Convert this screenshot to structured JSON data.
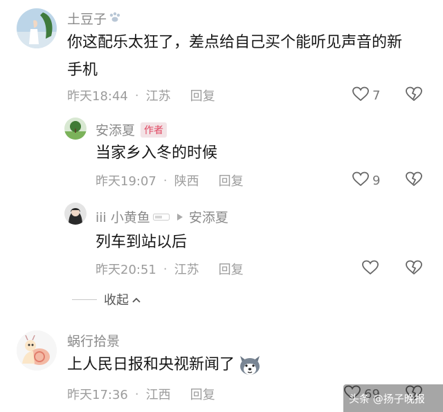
{
  "comments": [
    {
      "user": "土豆子",
      "text_line1": "你这配乐太狂了，差点给自己买个能听见声音的新",
      "text_line2": "手机",
      "time": "昨天18:44",
      "location": "江苏",
      "reply_label": "回复",
      "likes": "7"
    },
    {
      "user": "安添夏",
      "badge": "作者",
      "text": "当家乡入冬的时候",
      "time": "昨天19:07",
      "location": "陕西",
      "reply_label": "回复",
      "likes": "9"
    },
    {
      "user": "iii 小黄鱼",
      "reply_to": "安添夏",
      "text": "列车到站以后",
      "time": "昨天20:51",
      "location": "江苏",
      "reply_label": "回复",
      "likes": ""
    },
    {
      "user": "蜗行拾景",
      "text": "上人民日报和央视新闻了",
      "time": "昨天17:36",
      "location": "江西",
      "reply_label": "回复",
      "likes": "69"
    }
  ],
  "collapse_label": "收起",
  "watermark": "头条 @扬子晚报",
  "colors": {
    "author_badge": "#e04761",
    "meta_text": "#9c9c9c"
  }
}
